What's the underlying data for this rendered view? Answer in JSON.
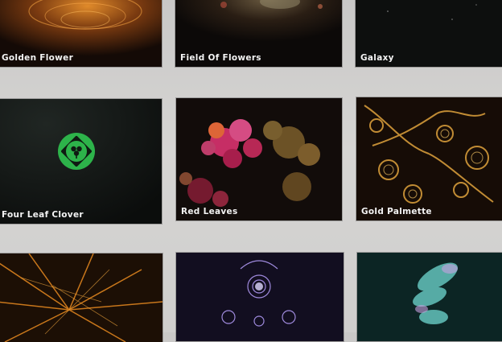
{
  "gallery": {
    "items": [
      {
        "title": "Golden Flower"
      },
      {
        "title": "Field Of Flowers"
      },
      {
        "title": "Galaxy"
      },
      {
        "title": "Four Leaf Clover"
      },
      {
        "title": "Red Leaves"
      },
      {
        "title": "Gold Palmette"
      },
      {
        "title": ""
      },
      {
        "title": ""
      },
      {
        "title": ""
      }
    ]
  },
  "icons": {
    "clover": "clover-icon"
  },
  "colors": {
    "page_bg": "#d3d2d0",
    "caption_text": "#f3f3f3",
    "clover_green": "#2db34a"
  }
}
